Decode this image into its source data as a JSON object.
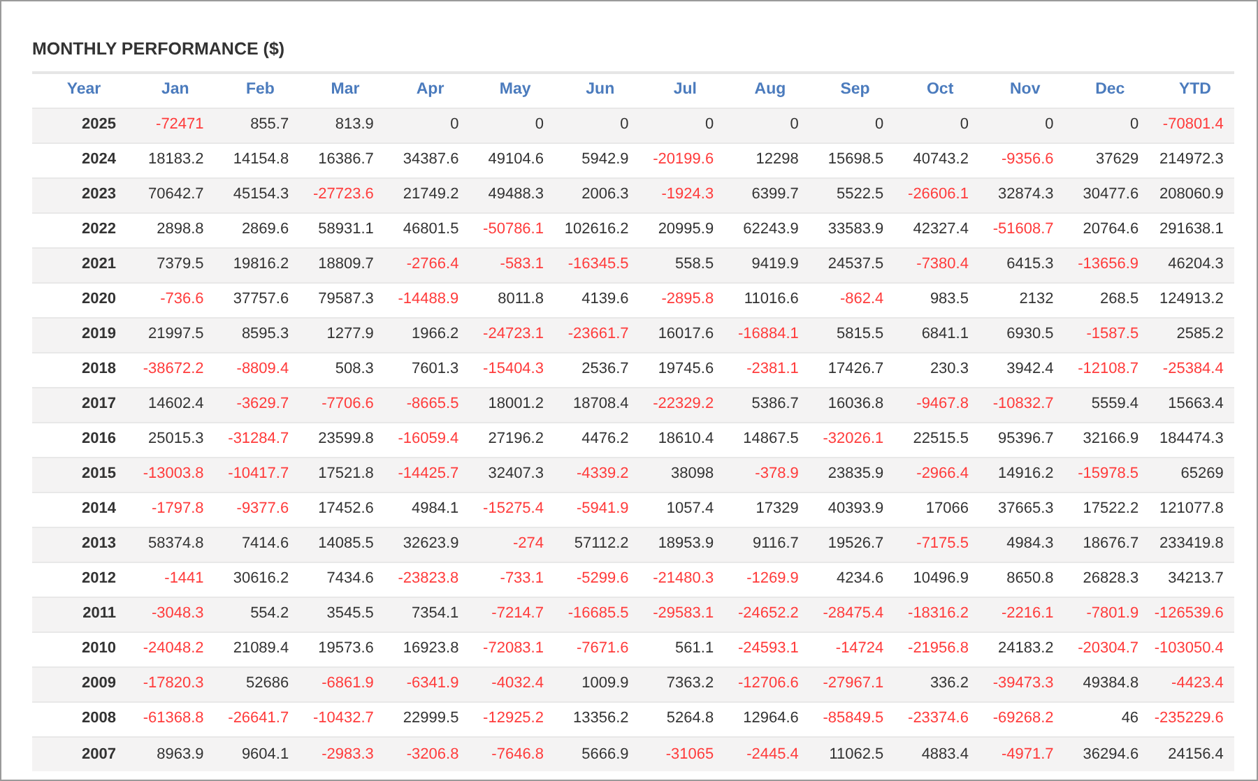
{
  "title": "MONTHLY PERFORMANCE ($)",
  "table": {
    "columns": [
      "Year",
      "Jan",
      "Feb",
      "Mar",
      "Apr",
      "May",
      "Jun",
      "Jul",
      "Aug",
      "Sep",
      "Oct",
      "Nov",
      "Dec",
      "YTD"
    ],
    "rows": [
      {
        "cells": [
          {
            "value": "2025",
            "negative": false
          },
          {
            "value": "-72471",
            "negative": true
          },
          {
            "value": "855.7",
            "negative": false
          },
          {
            "value": "813.9",
            "negative": false
          },
          {
            "value": "0",
            "negative": false
          },
          {
            "value": "0",
            "negative": false
          },
          {
            "value": "0",
            "negative": false
          },
          {
            "value": "0",
            "negative": false
          },
          {
            "value": "0",
            "negative": false
          },
          {
            "value": "0",
            "negative": false
          },
          {
            "value": "0",
            "negative": false
          },
          {
            "value": "0",
            "negative": false
          },
          {
            "value": "0",
            "negative": false
          },
          {
            "value": "-70801.4",
            "negative": true
          }
        ]
      },
      {
        "cells": [
          {
            "value": "2024",
            "negative": false
          },
          {
            "value": "18183.2",
            "negative": false
          },
          {
            "value": "14154.8",
            "negative": false
          },
          {
            "value": "16386.7",
            "negative": false
          },
          {
            "value": "34387.6",
            "negative": false
          },
          {
            "value": "49104.6",
            "negative": false
          },
          {
            "value": "5942.9",
            "negative": false
          },
          {
            "value": "-20199.6",
            "negative": true
          },
          {
            "value": "12298",
            "negative": false
          },
          {
            "value": "15698.5",
            "negative": false
          },
          {
            "value": "40743.2",
            "negative": false
          },
          {
            "value": "-9356.6",
            "negative": true
          },
          {
            "value": "37629",
            "negative": false
          },
          {
            "value": "214972.3",
            "negative": false
          }
        ]
      },
      {
        "cells": [
          {
            "value": "2023",
            "negative": false
          },
          {
            "value": "70642.7",
            "negative": false
          },
          {
            "value": "45154.3",
            "negative": false
          },
          {
            "value": "-27723.6",
            "negative": true
          },
          {
            "value": "21749.2",
            "negative": false
          },
          {
            "value": "49488.3",
            "negative": false
          },
          {
            "value": "2006.3",
            "negative": false
          },
          {
            "value": "-1924.3",
            "negative": true
          },
          {
            "value": "6399.7",
            "negative": false
          },
          {
            "value": "5522.5",
            "negative": false
          },
          {
            "value": "-26606.1",
            "negative": true
          },
          {
            "value": "32874.3",
            "negative": false
          },
          {
            "value": "30477.6",
            "negative": false
          },
          {
            "value": "208060.9",
            "negative": false
          }
        ]
      },
      {
        "cells": [
          {
            "value": "2022",
            "negative": false
          },
          {
            "value": "2898.8",
            "negative": false
          },
          {
            "value": "2869.6",
            "negative": false
          },
          {
            "value": "58931.1",
            "negative": false
          },
          {
            "value": "46801.5",
            "negative": false
          },
          {
            "value": "-50786.1",
            "negative": true
          },
          {
            "value": "102616.2",
            "negative": false
          },
          {
            "value": "20995.9",
            "negative": false
          },
          {
            "value": "62243.9",
            "negative": false
          },
          {
            "value": "33583.9",
            "negative": false
          },
          {
            "value": "42327.4",
            "negative": false
          },
          {
            "value": "-51608.7",
            "negative": true
          },
          {
            "value": "20764.6",
            "negative": false
          },
          {
            "value": "291638.1",
            "negative": false
          }
        ]
      },
      {
        "cells": [
          {
            "value": "2021",
            "negative": false
          },
          {
            "value": "7379.5",
            "negative": false
          },
          {
            "value": "19816.2",
            "negative": false
          },
          {
            "value": "18809.7",
            "negative": false
          },
          {
            "value": "-2766.4",
            "negative": true
          },
          {
            "value": "-583.1",
            "negative": true
          },
          {
            "value": "-16345.5",
            "negative": true
          },
          {
            "value": "558.5",
            "negative": false
          },
          {
            "value": "9419.9",
            "negative": false
          },
          {
            "value": "24537.5",
            "negative": false
          },
          {
            "value": "-7380.4",
            "negative": true
          },
          {
            "value": "6415.3",
            "negative": false
          },
          {
            "value": "-13656.9",
            "negative": true
          },
          {
            "value": "46204.3",
            "negative": false
          }
        ]
      },
      {
        "cells": [
          {
            "value": "2020",
            "negative": false
          },
          {
            "value": "-736.6",
            "negative": true
          },
          {
            "value": "37757.6",
            "negative": false
          },
          {
            "value": "79587.3",
            "negative": false
          },
          {
            "value": "-14488.9",
            "negative": true
          },
          {
            "value": "8011.8",
            "negative": false
          },
          {
            "value": "4139.6",
            "negative": false
          },
          {
            "value": "-2895.8",
            "negative": true
          },
          {
            "value": "11016.6",
            "negative": false
          },
          {
            "value": "-862.4",
            "negative": true
          },
          {
            "value": "983.5",
            "negative": false
          },
          {
            "value": "2132",
            "negative": false
          },
          {
            "value": "268.5",
            "negative": false
          },
          {
            "value": "124913.2",
            "negative": false
          }
        ]
      },
      {
        "cells": [
          {
            "value": "2019",
            "negative": false
          },
          {
            "value": "21997.5",
            "negative": false
          },
          {
            "value": "8595.3",
            "negative": false
          },
          {
            "value": "1277.9",
            "negative": false
          },
          {
            "value": "1966.2",
            "negative": false
          },
          {
            "value": "-24723.1",
            "negative": true
          },
          {
            "value": "-23661.7",
            "negative": true
          },
          {
            "value": "16017.6",
            "negative": false
          },
          {
            "value": "-16884.1",
            "negative": true
          },
          {
            "value": "5815.5",
            "negative": false
          },
          {
            "value": "6841.1",
            "negative": false
          },
          {
            "value": "6930.5",
            "negative": false
          },
          {
            "value": "-1587.5",
            "negative": true
          },
          {
            "value": "2585.2",
            "negative": false
          }
        ]
      },
      {
        "cells": [
          {
            "value": "2018",
            "negative": false
          },
          {
            "value": "-38672.2",
            "negative": true
          },
          {
            "value": "-8809.4",
            "negative": true
          },
          {
            "value": "508.3",
            "negative": false
          },
          {
            "value": "7601.3",
            "negative": false
          },
          {
            "value": "-15404.3",
            "negative": true
          },
          {
            "value": "2536.7",
            "negative": false
          },
          {
            "value": "19745.6",
            "negative": false
          },
          {
            "value": "-2381.1",
            "negative": true
          },
          {
            "value": "17426.7",
            "negative": false
          },
          {
            "value": "230.3",
            "negative": false
          },
          {
            "value": "3942.4",
            "negative": false
          },
          {
            "value": "-12108.7",
            "negative": true
          },
          {
            "value": "-25384.4",
            "negative": true
          }
        ]
      },
      {
        "cells": [
          {
            "value": "2017",
            "negative": false
          },
          {
            "value": "14602.4",
            "negative": false
          },
          {
            "value": "-3629.7",
            "negative": true
          },
          {
            "value": "-7706.6",
            "negative": true
          },
          {
            "value": "-8665.5",
            "negative": true
          },
          {
            "value": "18001.2",
            "negative": false
          },
          {
            "value": "18708.4",
            "negative": false
          },
          {
            "value": "-22329.2",
            "negative": true
          },
          {
            "value": "5386.7",
            "negative": false
          },
          {
            "value": "16036.8",
            "negative": false
          },
          {
            "value": "-9467.8",
            "negative": true
          },
          {
            "value": "-10832.7",
            "negative": true
          },
          {
            "value": "5559.4",
            "negative": false
          },
          {
            "value": "15663.4",
            "negative": false
          }
        ]
      },
      {
        "cells": [
          {
            "value": "2016",
            "negative": false
          },
          {
            "value": "25015.3",
            "negative": false
          },
          {
            "value": "-31284.7",
            "negative": true
          },
          {
            "value": "23599.8",
            "negative": false
          },
          {
            "value": "-16059.4",
            "negative": true
          },
          {
            "value": "27196.2",
            "negative": false
          },
          {
            "value": "4476.2",
            "negative": false
          },
          {
            "value": "18610.4",
            "negative": false
          },
          {
            "value": "14867.5",
            "negative": false
          },
          {
            "value": "-32026.1",
            "negative": true
          },
          {
            "value": "22515.5",
            "negative": false
          },
          {
            "value": "95396.7",
            "negative": false
          },
          {
            "value": "32166.9",
            "negative": false
          },
          {
            "value": "184474.3",
            "negative": false
          }
        ]
      },
      {
        "cells": [
          {
            "value": "2015",
            "negative": false
          },
          {
            "value": "-13003.8",
            "negative": true
          },
          {
            "value": "-10417.7",
            "negative": true
          },
          {
            "value": "17521.8",
            "negative": false
          },
          {
            "value": "-14425.7",
            "negative": true
          },
          {
            "value": "32407.3",
            "negative": false
          },
          {
            "value": "-4339.2",
            "negative": true
          },
          {
            "value": "38098",
            "negative": false
          },
          {
            "value": "-378.9",
            "negative": true
          },
          {
            "value": "23835.9",
            "negative": false
          },
          {
            "value": "-2966.4",
            "negative": true
          },
          {
            "value": "14916.2",
            "negative": false
          },
          {
            "value": "-15978.5",
            "negative": true
          },
          {
            "value": "65269",
            "negative": false
          }
        ]
      },
      {
        "cells": [
          {
            "value": "2014",
            "negative": false
          },
          {
            "value": "-1797.8",
            "negative": true
          },
          {
            "value": "-9377.6",
            "negative": true
          },
          {
            "value": "17452.6",
            "negative": false
          },
          {
            "value": "4984.1",
            "negative": false
          },
          {
            "value": "-15275.4",
            "negative": true
          },
          {
            "value": "-5941.9",
            "negative": true
          },
          {
            "value": "1057.4",
            "negative": false
          },
          {
            "value": "17329",
            "negative": false
          },
          {
            "value": "40393.9",
            "negative": false
          },
          {
            "value": "17066",
            "negative": false
          },
          {
            "value": "37665.3",
            "negative": false
          },
          {
            "value": "17522.2",
            "negative": false
          },
          {
            "value": "121077.8",
            "negative": false
          }
        ]
      },
      {
        "cells": [
          {
            "value": "2013",
            "negative": false
          },
          {
            "value": "58374.8",
            "negative": false
          },
          {
            "value": "7414.6",
            "negative": false
          },
          {
            "value": "14085.5",
            "negative": false
          },
          {
            "value": "32623.9",
            "negative": false
          },
          {
            "value": "-274",
            "negative": true
          },
          {
            "value": "57112.2",
            "negative": false
          },
          {
            "value": "18953.9",
            "negative": false
          },
          {
            "value": "9116.7",
            "negative": false
          },
          {
            "value": "19526.7",
            "negative": false
          },
          {
            "value": "-7175.5",
            "negative": true
          },
          {
            "value": "4984.3",
            "negative": false
          },
          {
            "value": "18676.7",
            "negative": false
          },
          {
            "value": "233419.8",
            "negative": false
          }
        ]
      },
      {
        "cells": [
          {
            "value": "2012",
            "negative": false
          },
          {
            "value": "-1441",
            "negative": true
          },
          {
            "value": "30616.2",
            "negative": false
          },
          {
            "value": "7434.6",
            "negative": false
          },
          {
            "value": "-23823.8",
            "negative": true
          },
          {
            "value": "-733.1",
            "negative": true
          },
          {
            "value": "-5299.6",
            "negative": true
          },
          {
            "value": "-21480.3",
            "negative": true
          },
          {
            "value": "-1269.9",
            "negative": true
          },
          {
            "value": "4234.6",
            "negative": false
          },
          {
            "value": "10496.9",
            "negative": false
          },
          {
            "value": "8650.8",
            "negative": false
          },
          {
            "value": "26828.3",
            "negative": false
          },
          {
            "value": "34213.7",
            "negative": false
          }
        ]
      },
      {
        "cells": [
          {
            "value": "2011",
            "negative": false
          },
          {
            "value": "-3048.3",
            "negative": true
          },
          {
            "value": "554.2",
            "negative": false
          },
          {
            "value": "3545.5",
            "negative": false
          },
          {
            "value": "7354.1",
            "negative": false
          },
          {
            "value": "-7214.7",
            "negative": true
          },
          {
            "value": "-16685.5",
            "negative": true
          },
          {
            "value": "-29583.1",
            "negative": true
          },
          {
            "value": "-24652.2",
            "negative": true
          },
          {
            "value": "-28475.4",
            "negative": true
          },
          {
            "value": "-18316.2",
            "negative": true
          },
          {
            "value": "-2216.1",
            "negative": true
          },
          {
            "value": "-7801.9",
            "negative": true
          },
          {
            "value": "-126539.6",
            "negative": true
          }
        ]
      },
      {
        "cells": [
          {
            "value": "2010",
            "negative": false
          },
          {
            "value": "-24048.2",
            "negative": true
          },
          {
            "value": "21089.4",
            "negative": false
          },
          {
            "value": "19573.6",
            "negative": false
          },
          {
            "value": "16923.8",
            "negative": false
          },
          {
            "value": "-72083.1",
            "negative": true
          },
          {
            "value": "-7671.6",
            "negative": true
          },
          {
            "value": "561.1",
            "negative": false
          },
          {
            "value": "-24593.1",
            "negative": true
          },
          {
            "value": "-14724",
            "negative": true
          },
          {
            "value": "-21956.8",
            "negative": true
          },
          {
            "value": "24183.2",
            "negative": false
          },
          {
            "value": "-20304.7",
            "negative": true
          },
          {
            "value": "-103050.4",
            "negative": true
          }
        ]
      },
      {
        "cells": [
          {
            "value": "2009",
            "negative": false
          },
          {
            "value": "-17820.3",
            "negative": true
          },
          {
            "value": "52686",
            "negative": false
          },
          {
            "value": "-6861.9",
            "negative": true
          },
          {
            "value": "-6341.9",
            "negative": true
          },
          {
            "value": "-4032.4",
            "negative": true
          },
          {
            "value": "1009.9",
            "negative": false
          },
          {
            "value": "7363.2",
            "negative": false
          },
          {
            "value": "-12706.6",
            "negative": true
          },
          {
            "value": "-27967.1",
            "negative": true
          },
          {
            "value": "336.2",
            "negative": false
          },
          {
            "value": "-39473.3",
            "negative": true
          },
          {
            "value": "49384.8",
            "negative": false
          },
          {
            "value": "-4423.4",
            "negative": true
          }
        ]
      },
      {
        "cells": [
          {
            "value": "2008",
            "negative": false
          },
          {
            "value": "-61368.8",
            "negative": true
          },
          {
            "value": "-26641.7",
            "negative": true
          },
          {
            "value": "-10432.7",
            "negative": true
          },
          {
            "value": "22999.5",
            "negative": false
          },
          {
            "value": "-12925.2",
            "negative": true
          },
          {
            "value": "13356.2",
            "negative": false
          },
          {
            "value": "5264.8",
            "negative": false
          },
          {
            "value": "12964.6",
            "negative": false
          },
          {
            "value": "-85849.5",
            "negative": true
          },
          {
            "value": "-23374.6",
            "negative": true
          },
          {
            "value": "-69268.2",
            "negative": true
          },
          {
            "value": "46",
            "negative": false
          },
          {
            "value": "-235229.6",
            "negative": true
          }
        ]
      },
      {
        "cells": [
          {
            "value": "2007",
            "negative": false
          },
          {
            "value": "8963.9",
            "negative": false
          },
          {
            "value": "9604.1",
            "negative": false
          },
          {
            "value": "-2983.3",
            "negative": true
          },
          {
            "value": "-3206.8",
            "negative": true
          },
          {
            "value": "-7646.8",
            "negative": true
          },
          {
            "value": "5666.9",
            "negative": false
          },
          {
            "value": "-31065",
            "negative": true
          },
          {
            "value": "-2445.4",
            "negative": true
          },
          {
            "value": "11062.5",
            "negative": false
          },
          {
            "value": "4883.4",
            "negative": false
          },
          {
            "value": "-4971.7",
            "negative": true
          },
          {
            "value": "36294.6",
            "negative": false
          },
          {
            "value": "24156.4",
            "negative": false
          }
        ]
      }
    ]
  }
}
